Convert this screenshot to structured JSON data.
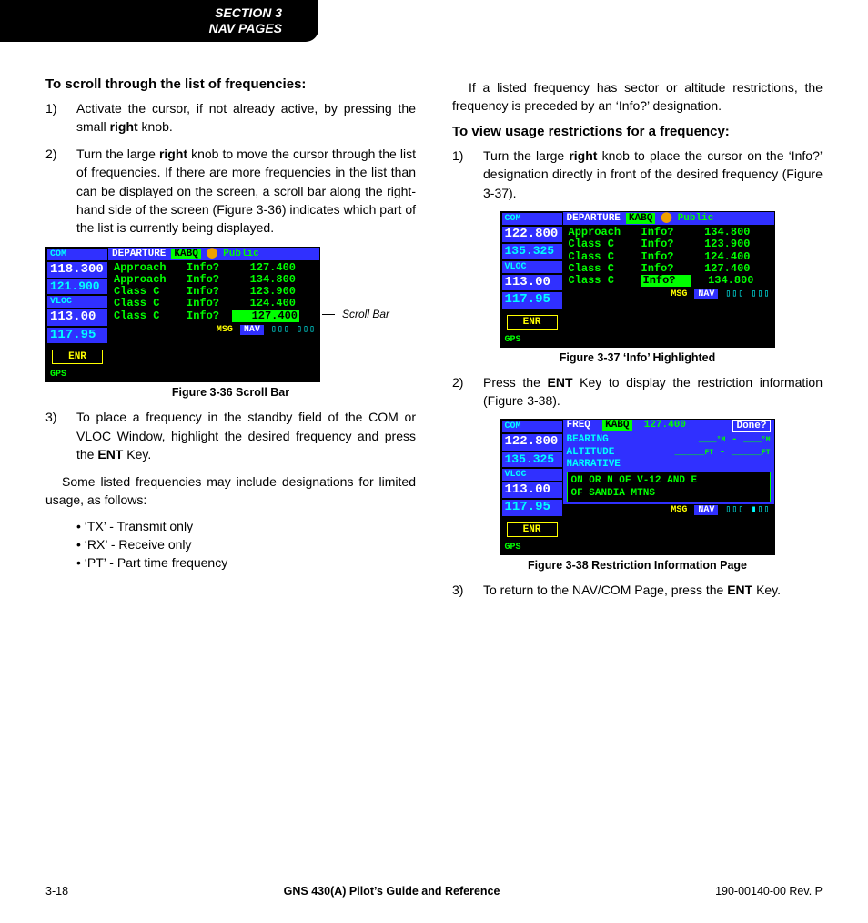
{
  "section_tab": {
    "l1": "SECTION 3",
    "l2": "NAV PAGES"
  },
  "left": {
    "heading": "To scroll through the list of frequencies:",
    "steps_a": [
      {
        "n": "1)",
        "html": "Activate the cursor, if not already active, by pressing the small <b>right</b> knob."
      },
      {
        "n": "2)",
        "html": "Turn the large <b>right</b> knob to move the cursor through the list of frequencies.  If there are more frequencies in the list than can be displayed on the screen, a scroll bar along the right-hand side of the screen (Figure 3-36) indicates which part of the list is currently being displayed."
      }
    ],
    "fig36": {
      "caption": "Figure 3-36  Scroll Bar",
      "scrollbar_label": "Scroll Bar",
      "side": {
        "com": "COM",
        "com_a": "118.300",
        "com_s": "121.900",
        "vloc": "VLOC",
        "vloc_a": "113.00",
        "vloc_s": "117.95",
        "enr": "ENR",
        "gps": "GPS"
      },
      "title": {
        "dep": "DEPARTURE",
        "apt": "KABQ",
        "pub": "Public"
      },
      "rows": [
        {
          "c1": "Approach",
          "c2": "Info?",
          "c3": "127.400"
        },
        {
          "c1": "Approach",
          "c2": "Info?",
          "c3": "134.800"
        },
        {
          "c1": "Class C",
          "c2": "Info?",
          "c3": "123.900"
        },
        {
          "c1": "Class C",
          "c2": "Info?",
          "c3": "124.400"
        },
        {
          "c1": "Class C",
          "c2": "Info?",
          "c3": "127.400",
          "hl": "c3"
        }
      ],
      "footer": {
        "msg": "MSG",
        "nav": "NAV",
        "boxes": "▯▯▯ ▯▯▯"
      }
    },
    "steps_b": [
      {
        "n": "3)",
        "html": "To place a frequency in the standby field of the COM or VLOC Window, highlight the desired frequency and press the <b>ENT</b> Key."
      }
    ],
    "para": "Some listed frequencies may include designations for limited usage, as follows:",
    "bullets": [
      "‘TX’ - Transmit only",
      "‘RX’ - Receive only",
      "‘PT’ - Part time frequency"
    ]
  },
  "right": {
    "para1": "If a listed frequency has sector or altitude restrictions, the frequency is preceded by an ‘Info?’ designation.",
    "heading": "To view usage restrictions for a frequency:",
    "steps_a": [
      {
        "n": "1)",
        "html": "Turn the large <b>right</b> knob to place the cursor on the ‘Info?’ designation directly in front of the desired frequency (Figure 3-37)."
      }
    ],
    "fig37": {
      "caption": "Figure 3-37  ‘Info’ Highlighted",
      "side": {
        "com": "COM",
        "com_a": "122.800",
        "com_s": "135.325",
        "vloc": "VLOC",
        "vloc_a": "113.00",
        "vloc_s": "117.95",
        "enr": "ENR",
        "gps": "GPS"
      },
      "title": {
        "dep": "DEPARTURE",
        "apt": "KABQ",
        "pub": "Public"
      },
      "rows": [
        {
          "c1": "Approach",
          "c2": "Info?",
          "c3": "134.800"
        },
        {
          "c1": "Class C",
          "c2": "Info?",
          "c3": "123.900"
        },
        {
          "c1": "Class C",
          "c2": "Info?",
          "c3": "124.400"
        },
        {
          "c1": "Class C",
          "c2": "Info?",
          "c3": "127.400"
        },
        {
          "c1": "Class C",
          "c2": "Info?",
          "c3": "134.800",
          "hl": "c2"
        }
      ],
      "footer": {
        "msg": "MSG",
        "nav": "NAV",
        "boxes": "▯▯▯ ▯▯▯"
      }
    },
    "steps_b": [
      {
        "n": "2)",
        "html": "Press the <b>ENT</b> Key to display the restriction information (Figure 3-38)."
      }
    ],
    "fig38": {
      "caption": "Figure 3-38  Restriction Information Page",
      "side": {
        "com": "COM",
        "com_a": "122.800",
        "com_s": "135.325",
        "vloc": "VLOC",
        "vloc_a": "113.00",
        "vloc_s": "117.95",
        "enr": "ENR",
        "gps": "GPS"
      },
      "title": {
        "freq": "FREQ",
        "apt": "KABQ",
        "val": "127.400",
        "done": "Done?"
      },
      "bearing_label": "BEARING",
      "bearing_val": "___° - ___°",
      "alt_label": "ALTITUDE",
      "alt_val": "_____ - _____",
      "narr_label": "NARRATIVE",
      "narr_text1": "ON OR N OF V-12 AND E",
      "narr_text2": "OF SANDIA MTNS",
      "footer": {
        "msg": "MSG",
        "nav": "NAV",
        "boxes": "▯▯▯ ▮▯▯"
      }
    },
    "steps_c": [
      {
        "n": "3)",
        "html": "To return to the NAV/COM Page, press the <b>ENT</b> Key."
      }
    ]
  },
  "footer": {
    "left": "3-18",
    "mid": "GNS 430(A) Pilot’s Guide and Reference",
    "right": "190-00140-00  Rev. P"
  }
}
